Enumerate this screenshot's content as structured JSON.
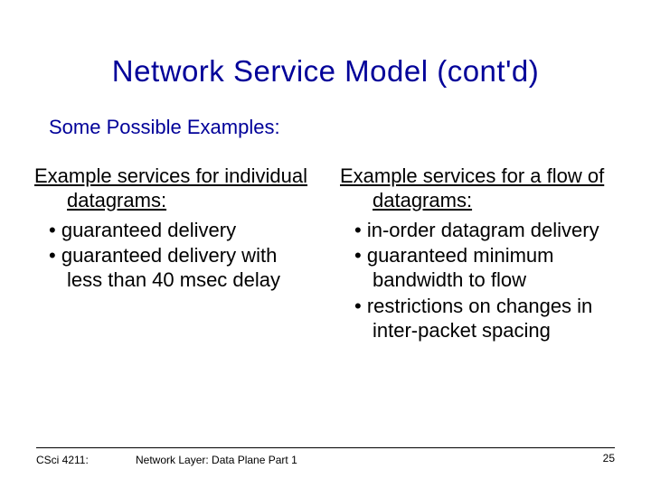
{
  "title": "Network Service Model (cont'd)",
  "subtitle": "Some Possible Examples:",
  "left": {
    "heading": "Example services for individual datagrams:",
    "items": [
      "guaranteed delivery",
      "guaranteed delivery with less than 40 msec delay"
    ]
  },
  "right": {
    "heading": "Example services for a flow of datagrams:",
    "items": [
      "in-order datagram delivery",
      "guaranteed minimum bandwidth to flow",
      "restrictions on changes in inter-packet spacing"
    ]
  },
  "footer": {
    "course": "CSci 4211:",
    "title": "Network Layer: Data Plane Part 1",
    "page": "25"
  }
}
